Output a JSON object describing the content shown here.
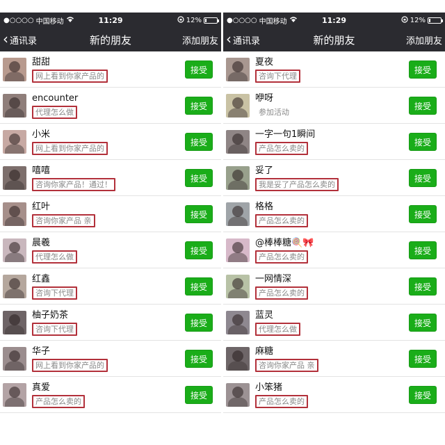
{
  "colors": {
    "header_bg": "#2b2b30",
    "accept_green": "#1aad19",
    "highlight_border": "#b2303a"
  },
  "status_bar": {
    "carrier": "中国移动",
    "time": "11:29",
    "battery": "12%",
    "battery_level": 0.12,
    "signal_icon": "signal-dots-icon",
    "wifi_icon": "wifi-icon",
    "lock_icon": "rotation-lock-icon"
  },
  "navbar": {
    "back_label": "通讯录",
    "title": "新的朋友",
    "add_label": "添加朋友"
  },
  "accept_label": "接受",
  "left_list": [
    {
      "name": "甜甜",
      "message": "网上看到你家产品的",
      "highlighted": true,
      "avatar_color": "#b89a8e"
    },
    {
      "name": "encounter",
      "message": "代理怎么做",
      "highlighted": true,
      "avatar_color": "#8f7e7a"
    },
    {
      "name": "小米",
      "message": "网上看到你家产品的",
      "highlighted": true,
      "avatar_color": "#c7a9a3"
    },
    {
      "name": "嘻嘻",
      "message": "咨询你家产品！通过！",
      "highlighted": true,
      "avatar_color": "#7d6f6c"
    },
    {
      "name": "红叶",
      "message": "咨询你家产品 亲",
      "highlighted": true,
      "avatar_color": "#a68f8a"
    },
    {
      "name": "晨羲",
      "message": "代理怎么做",
      "highlighted": true,
      "avatar_color": "#c9b7bd"
    },
    {
      "name": "红鑫",
      "message": "咨询下代理",
      "highlighted": true,
      "avatar_color": "#b5a79d"
    },
    {
      "name": "柚子奶茶",
      "message": "咨询下代理",
      "highlighted": true,
      "avatar_color": "#6e6466"
    },
    {
      "name": "华子",
      "message": "网上看到你家产品的",
      "highlighted": true,
      "avatar_color": "#9b8d8e"
    },
    {
      "name": "真爱",
      "message": "产品怎么卖的",
      "highlighted": true,
      "avatar_color": "#b3a3a5"
    }
  ],
  "right_list": [
    {
      "name": "夏夜",
      "message": "咨询下代理",
      "highlighted": true,
      "avatar_color": "#a89790"
    },
    {
      "name": "咿呀",
      "message": "参加活动",
      "highlighted": false,
      "avatar_color": "#c9c2a4"
    },
    {
      "name": "一字一句1瞬间",
      "message": "产品怎么卖的",
      "highlighted": true,
      "avatar_color": "#8f8585"
    },
    {
      "name": "妥了",
      "message": "我是妥了产品怎么卖的",
      "highlighted": true,
      "avatar_color": "#98a08c"
    },
    {
      "name": "格格",
      "message": "产品怎么卖的",
      "highlighted": true,
      "avatar_color": "#9fa4a8"
    },
    {
      "name": "@棒棒糖🍭🎀",
      "message": "产品怎么卖的",
      "highlighted": true,
      "avatar_color": "#d7b9c9"
    },
    {
      "name": "一网情深",
      "message": "产品怎么卖的",
      "highlighted": true,
      "avatar_color": "#b8c2a6"
    },
    {
      "name": "蓝灵",
      "message": "代理怎么做",
      "highlighted": true,
      "avatar_color": "#8e8890"
    },
    {
      "name": "麻糖",
      "message": "咨询你家产品 亲",
      "highlighted": true,
      "avatar_color": "#6e6668"
    },
    {
      "name": "小笨猪",
      "message": "产品怎么卖的",
      "highlighted": true,
      "avatar_color": "#9c9294"
    }
  ]
}
